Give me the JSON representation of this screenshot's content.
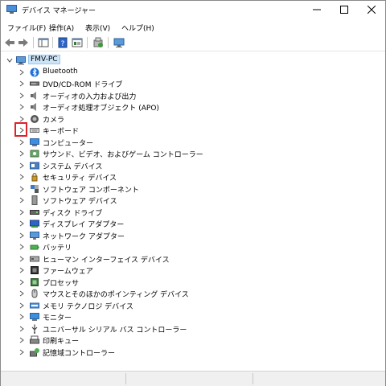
{
  "window": {
    "title": "デバイス マネージャー"
  },
  "menu": [
    {
      "label": "ファイル(F)"
    },
    {
      "label": "操作(A)"
    },
    {
      "label": "表示(V)"
    },
    {
      "label": "ヘルプ(H)"
    }
  ],
  "tree": {
    "root": "FMV-PC",
    "items": [
      {
        "label": "Bluetooth",
        "icon": "bluetooth-icon"
      },
      {
        "label": "DVD/CD-ROM ドライブ",
        "icon": "dvd-drive-icon"
      },
      {
        "label": "オーディオの入力および出力",
        "icon": "speaker-icon"
      },
      {
        "label": "オーディオ処理オブジェクト (APO)",
        "icon": "speaker-icon"
      },
      {
        "label": "カメラ",
        "icon": "camera-icon"
      },
      {
        "label": "キーボード",
        "icon": "keyboard-icon"
      },
      {
        "label": "コンピューター",
        "icon": "computer-icon"
      },
      {
        "label": "サウンド、ビデオ、およびゲーム コントローラー",
        "icon": "sound-icon"
      },
      {
        "label": "システム デバイス",
        "icon": "system-device-icon"
      },
      {
        "label": "セキュリティ デバイス",
        "icon": "security-device-icon"
      },
      {
        "label": "ソフトウェア コンポーネント",
        "icon": "software-component-icon"
      },
      {
        "label": "ソフトウェア デバイス",
        "icon": "software-device-icon"
      },
      {
        "label": "ディスク ドライブ",
        "icon": "disk-drive-icon"
      },
      {
        "label": "ディスプレイ アダプター",
        "icon": "display-adapter-icon"
      },
      {
        "label": "ネットワーク アダプター",
        "icon": "network-adapter-icon"
      },
      {
        "label": "バッテリ",
        "icon": "battery-icon"
      },
      {
        "label": "ヒューマン インターフェイス デバイス",
        "icon": "hid-icon"
      },
      {
        "label": "ファームウェア",
        "icon": "firmware-icon"
      },
      {
        "label": "プロセッサ",
        "icon": "processor-icon"
      },
      {
        "label": "マウスとそのほかのポインティング デバイス",
        "icon": "mouse-icon"
      },
      {
        "label": "メモリ テクノロジ デバイス",
        "icon": "memory-device-icon"
      },
      {
        "label": "モニター",
        "icon": "monitor-icon"
      },
      {
        "label": "ユニバーサル シリアル バス コントローラー",
        "icon": "usb-icon"
      },
      {
        "label": "印刷キュー",
        "icon": "print-queue-icon"
      },
      {
        "label": "記憶域コントローラー",
        "icon": "storage-controller-icon"
      }
    ]
  },
  "colors": {
    "highlight": "#e0202a",
    "selection": "#cce4f7"
  }
}
